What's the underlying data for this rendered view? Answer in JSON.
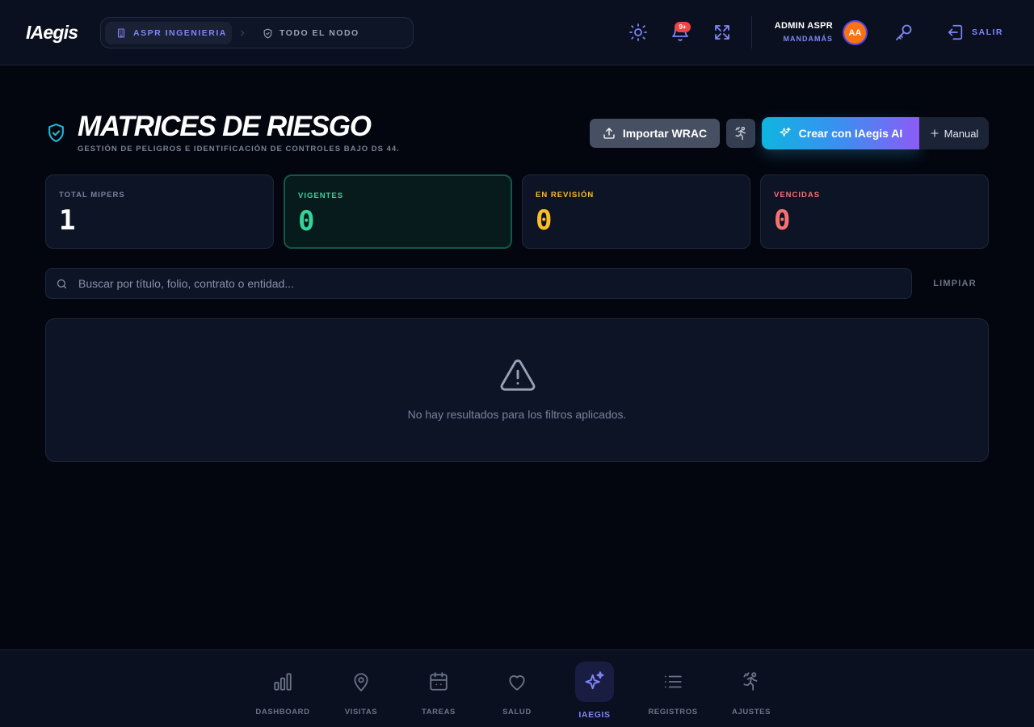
{
  "app": {
    "logo": "IAegis"
  },
  "header": {
    "breadcrumb": {
      "company": "ASPR INGENIERIA",
      "scope": "TODO EL NODO"
    },
    "notifications_badge": "9+",
    "user": {
      "name": "ADMIN ASPR",
      "role": "MANDAMÁS",
      "initials": "AA"
    },
    "logout_label": "SALIR"
  },
  "page": {
    "title": "MATRICES DE RIESGO",
    "subtitle": "GESTIÓN DE PELIGROS E IDENTIFICACIÓN DE CONTROLES BAJO DS 44.",
    "actions": {
      "import_label": "Importar WRAC",
      "ai_label": "Crear con IAegis AI",
      "manual_label": "Manual"
    }
  },
  "stats": [
    {
      "label": "TOTAL MIPERS",
      "value": "1",
      "color": "#ffffff",
      "label_color": "#7b8299"
    },
    {
      "label": "VIGENTES",
      "value": "0",
      "color": "#34d399",
      "label_color": "#34d399"
    },
    {
      "label": "EN REVISIÓN",
      "value": "0",
      "color": "#fbbf24",
      "label_color": "#fbbf24"
    },
    {
      "label": "VENCIDAS",
      "value": "0",
      "color": "#f87171",
      "label_color": "#f87171"
    }
  ],
  "search": {
    "placeholder": "Buscar por título, folio, contrato o entidad...",
    "value": "",
    "clear_label": "LIMPIAR"
  },
  "empty_state": {
    "message": "No hay resultados para los filtros aplicados."
  },
  "bottom_nav": [
    {
      "label": "DASHBOARD",
      "icon": "bar-chart-icon"
    },
    {
      "label": "VISITAS",
      "icon": "map-pin-icon"
    },
    {
      "label": "TAREAS",
      "icon": "calendar-icon"
    },
    {
      "label": "SALUD",
      "icon": "heart-icon"
    },
    {
      "label": "IAEGIS",
      "icon": "sparkles-icon",
      "active": true
    },
    {
      "label": "REGISTROS",
      "icon": "list-icon"
    },
    {
      "label": "AJUSTES",
      "icon": "runner-icon"
    }
  ],
  "colors": {
    "accent": "#7e86f6",
    "background": "#03060f",
    "card": "#0d1426",
    "ai_gradient_start": "#0fb5e0",
    "ai_gradient_end": "#8b5cf6"
  }
}
